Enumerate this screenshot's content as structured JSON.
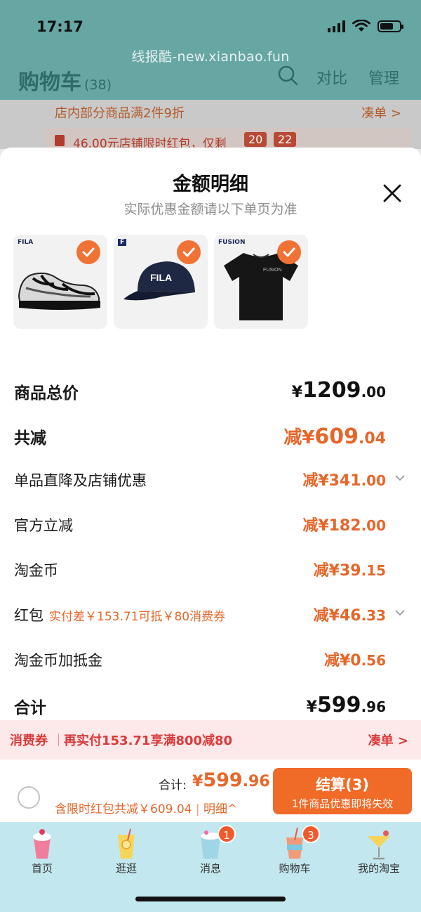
{
  "status": {
    "time": "17:17"
  },
  "watermark": "线报酷-new.xianbao.fun",
  "cart_header": {
    "title": "购物车",
    "count": "(38)",
    "compare": "对比",
    "manage": "管理"
  },
  "promo": {
    "text": "店内部分商品满2件9折",
    "link": "凑单 >"
  },
  "redpack_bar": {
    "text": "46.00元店铺限时红包，仅剩",
    "timer_h": "20",
    "timer_m": "22"
  },
  "sheet": {
    "title": "金额明细",
    "subtitle": "实际优惠金额请以下单页为准",
    "products": [
      {
        "brand": "FILA",
        "name": "sneaker"
      },
      {
        "brand": "F",
        "name": "cap"
      },
      {
        "brand": "FUSION",
        "name": "t-shirt"
      }
    ],
    "rows": {
      "total_price": {
        "label": "商品总价",
        "currency": "¥",
        "int": "1209",
        "dec": ".00"
      },
      "total_reduce": {
        "label": "共减",
        "prefix": "减¥",
        "int": "609",
        "dec": ".04"
      },
      "item_discount": {
        "label": "单品直降及店铺优惠",
        "prefix": "减¥",
        "int": "341",
        "dec": ".00"
      },
      "official": {
        "label": "官方立减",
        "prefix": "减¥",
        "int": "182",
        "dec": ".00"
      },
      "taojinbi": {
        "label": "淘金币",
        "prefix": "减¥",
        "int": "39",
        "dec": ".15"
      },
      "hongbao": {
        "label": "红包",
        "hint": "实付差￥153.71可抵￥80消费券",
        "prefix": "减¥",
        "int": "46",
        "dec": ".33"
      },
      "taojinbi_extra": {
        "label": "淘金币加抵金",
        "prefix": "减¥",
        "int": "0",
        "dec": ".56"
      },
      "sum": {
        "label": "合计",
        "currency": "¥",
        "int": "599",
        "dec": ".96"
      }
    }
  },
  "coupon": {
    "tag": "消费券",
    "text": "再实付153.71享满800减80",
    "link": "凑单 >"
  },
  "checkout": {
    "total_label": "合计:",
    "currency": "¥",
    "int": "599",
    "dec": ".96",
    "discount_text": "含限时红包共减￥609.04",
    "detail": "明细^",
    "button_title": "结算(3)",
    "button_sub": "1件商品优惠即将失效"
  },
  "tabs": [
    {
      "label": "首页",
      "icon": "home-drink-icon",
      "badge": ""
    },
    {
      "label": "逛逛",
      "icon": "browse-drink-icon",
      "badge": ""
    },
    {
      "label": "消息",
      "icon": "message-drink-icon",
      "badge": "1"
    },
    {
      "label": "购物车",
      "icon": "cart-drink-icon",
      "badge": "3"
    },
    {
      "label": "我的淘宝",
      "icon": "profile-drink-icon",
      "badge": ""
    }
  ],
  "colors": {
    "accent": "#f06a28",
    "discount": "#e5672a",
    "coupon_red": "#d93b3b",
    "header_teal": "#66a7a4",
    "tabbar_bg": "#c2e7ee"
  }
}
